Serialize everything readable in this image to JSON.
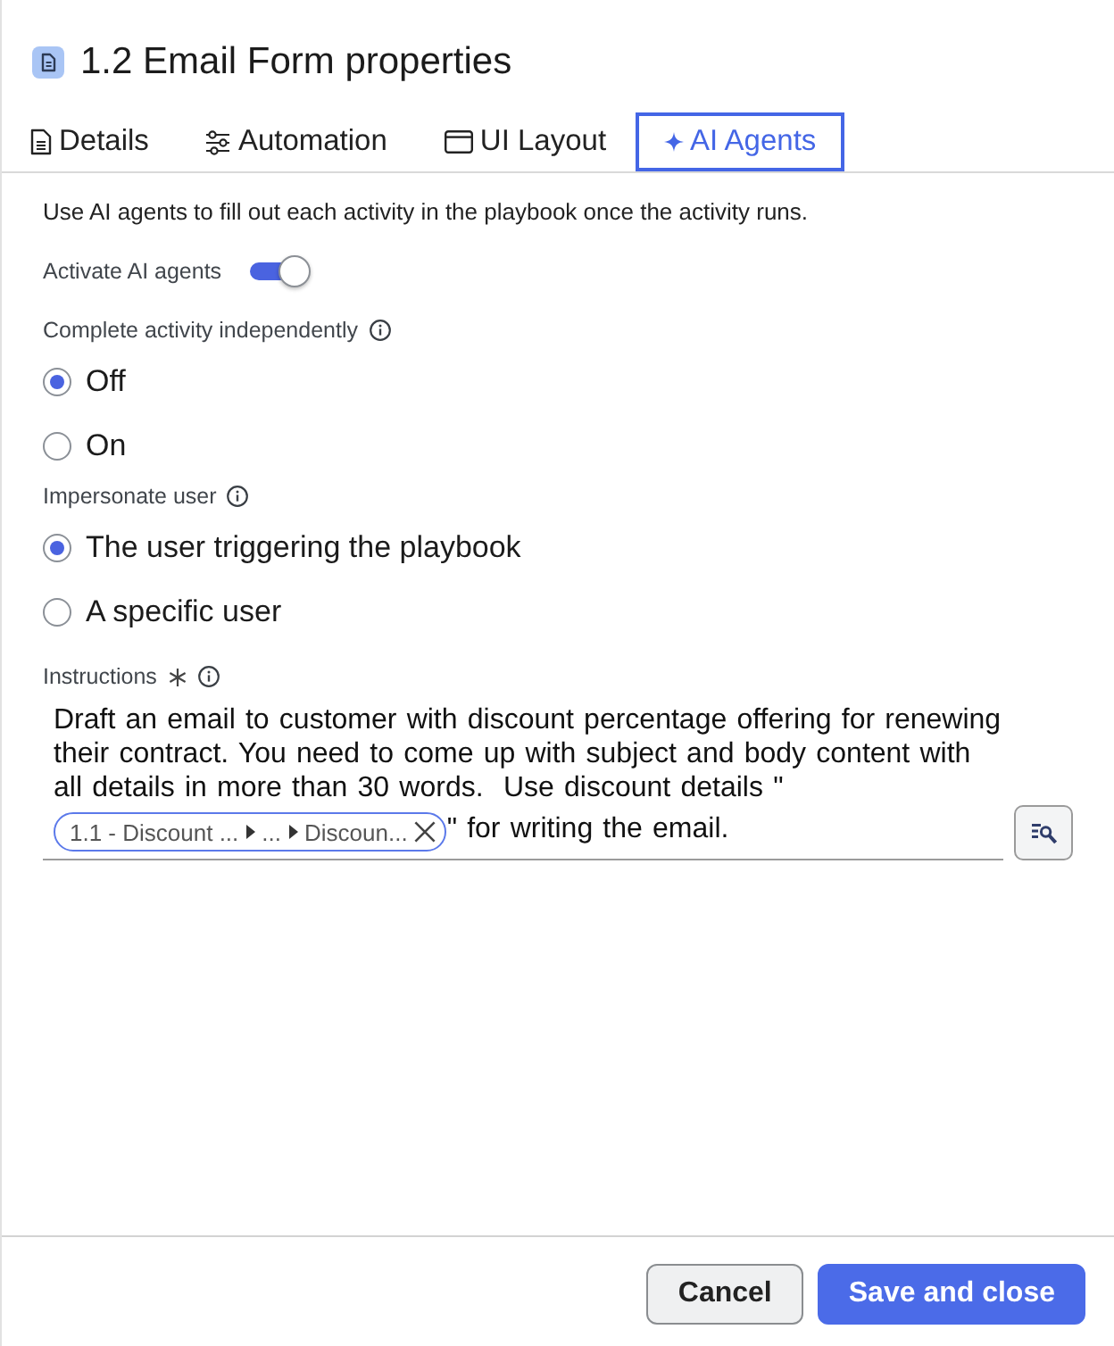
{
  "header": {
    "title": "1.2 Email Form properties"
  },
  "tabs": [
    {
      "label": "Details",
      "selected": false
    },
    {
      "label": "Automation",
      "selected": false
    },
    {
      "label": "UI Layout",
      "selected": false
    },
    {
      "label": "AI Agents",
      "selected": true
    }
  ],
  "intro": "Use AI agents to fill out each activity in the playbook once the activity runs.",
  "activate": {
    "label": "Activate AI agents",
    "on": true
  },
  "complete_activity": {
    "label": "Complete activity independently",
    "options": [
      {
        "label": "Off",
        "selected": true
      },
      {
        "label": "On",
        "selected": false
      }
    ]
  },
  "impersonate": {
    "label": "Impersonate user",
    "options": [
      {
        "label": "The user triggering the playbook",
        "selected": true
      },
      {
        "label": "A specific user",
        "selected": false
      }
    ]
  },
  "instructions": {
    "label": "Instructions",
    "required": true,
    "text_before": "Draft an email to customer with discount percentage offering for renewing their contract. You need to come up with subject and body content with all details in more than 30 words.  Use discount details \"",
    "chip": {
      "segments": [
        "1.1 - Discount ...",
        "...",
        "Discoun..."
      ]
    },
    "text_after": "\" for writing the email."
  },
  "footer": {
    "buttons": [
      {
        "label": "Cancel",
        "kind": "secondary"
      },
      {
        "label": "Save and close",
        "kind": "primary"
      }
    ]
  }
}
